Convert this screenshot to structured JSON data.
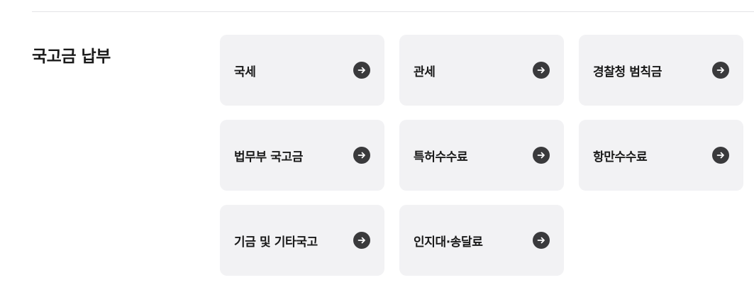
{
  "section": {
    "title": "국고금 납부"
  },
  "items": [
    {
      "label": "국세"
    },
    {
      "label": "관세"
    },
    {
      "label": "경찰청 범칙금"
    },
    {
      "label": "법무부 국고금"
    },
    {
      "label": "특허수수료"
    },
    {
      "label": "항만수수료"
    },
    {
      "label": "기금 및 기타국고"
    },
    {
      "label": "인지대·송달료"
    }
  ],
  "icons": {
    "arrow": "arrow-right-circle-icon"
  },
  "colors": {
    "card_background": "#f2f2f4",
    "icon_background": "#3a3a3c",
    "text": "#1a1a1a"
  }
}
